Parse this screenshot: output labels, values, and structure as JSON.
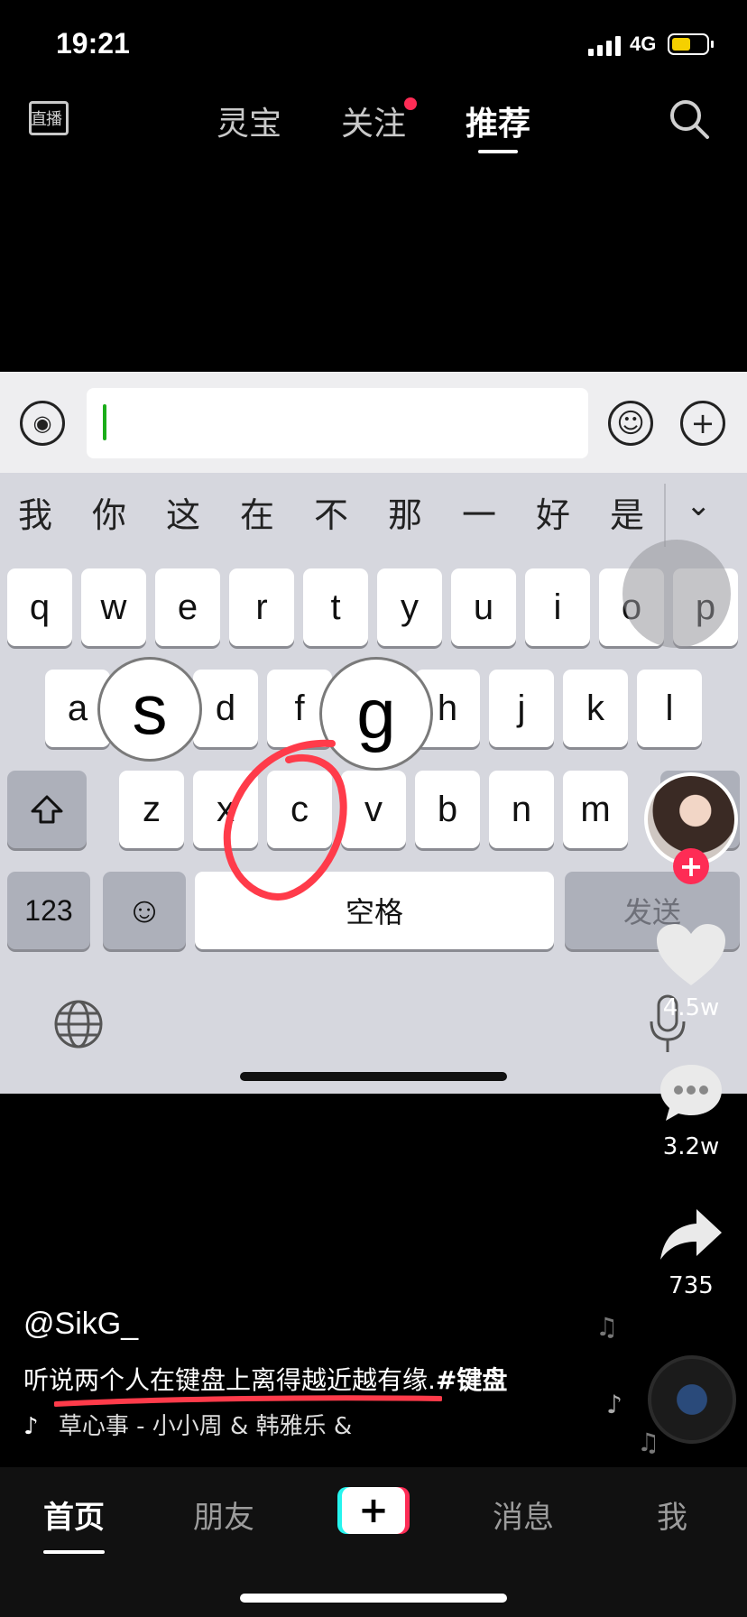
{
  "status_bar": {
    "time": "19:21",
    "network": "4G"
  },
  "top_nav": {
    "live_label": "直播",
    "tabs": [
      {
        "label": "灵宝",
        "active": false
      },
      {
        "label": "关注",
        "active": false,
        "notification": true
      },
      {
        "label": "推荐",
        "active": true
      }
    ]
  },
  "video": {
    "keyboard": {
      "candidates": [
        "我",
        "你",
        "这",
        "在",
        "不",
        "那",
        "一",
        "好",
        "是"
      ],
      "row1": [
        "q",
        "w",
        "e",
        "r",
        "t",
        "y",
        "u",
        "i",
        "o",
        "p"
      ],
      "row2": [
        "a",
        "s",
        "d",
        "f",
        "g",
        "h",
        "j",
        "k",
        "l"
      ],
      "row3": [
        "z",
        "x",
        "c",
        "v",
        "b",
        "n",
        "m"
      ],
      "key_123": "123",
      "space_label": "空格",
      "send_label": "发送",
      "popup_keys": [
        "s",
        "g"
      ],
      "circled_key": "c"
    }
  },
  "actions": {
    "likes": "4.5w",
    "comments": "3.2w",
    "shares": "735"
  },
  "caption": {
    "author": "@SikG_",
    "description": "听说两个人在键盘上离得越近越有缘.",
    "hashtag": "#键盘",
    "music": "草心事 - 小小周 & 韩雅乐 &"
  },
  "bottom_nav": {
    "tabs": [
      {
        "label": "首页",
        "active": true
      },
      {
        "label": "朋友",
        "active": false
      },
      {
        "label": "消息",
        "active": false
      },
      {
        "label": "我",
        "active": false
      }
    ]
  },
  "colors": {
    "accent": "#fe2c55",
    "cyan": "#25f4ee",
    "annotation": "#ff3b4a"
  }
}
